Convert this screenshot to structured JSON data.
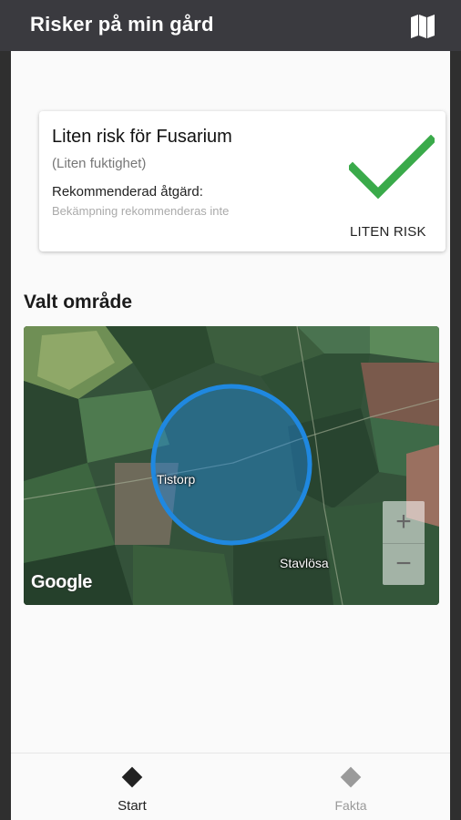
{
  "app": {
    "title": "Risker på min gård",
    "map_icon": "map-icon"
  },
  "risk_card": {
    "heading": "Liten risk för Fusarium",
    "subtitle": "(Liten fuktighet)",
    "recommendation_label": "Rekommenderad åtgärd:",
    "recommendation_value": "Bekämpning rekommenderas inte",
    "risk_level": "LITEN RISK",
    "status_icon": "checkmark-icon",
    "status_color": "#3aaa4a"
  },
  "section": {
    "title": "Valt område"
  },
  "map": {
    "places": [
      "Tistorp",
      "Stavlösa"
    ],
    "attribution": "Google",
    "zoom_in_label": "+",
    "zoom_out_label": "−",
    "selection_color": "#1f88e0"
  },
  "bottom_nav": {
    "items": [
      {
        "label": "Start",
        "icon": "diamond-icon",
        "active": true
      },
      {
        "label": "Fakta",
        "icon": "diamond-icon",
        "active": false
      }
    ]
  }
}
